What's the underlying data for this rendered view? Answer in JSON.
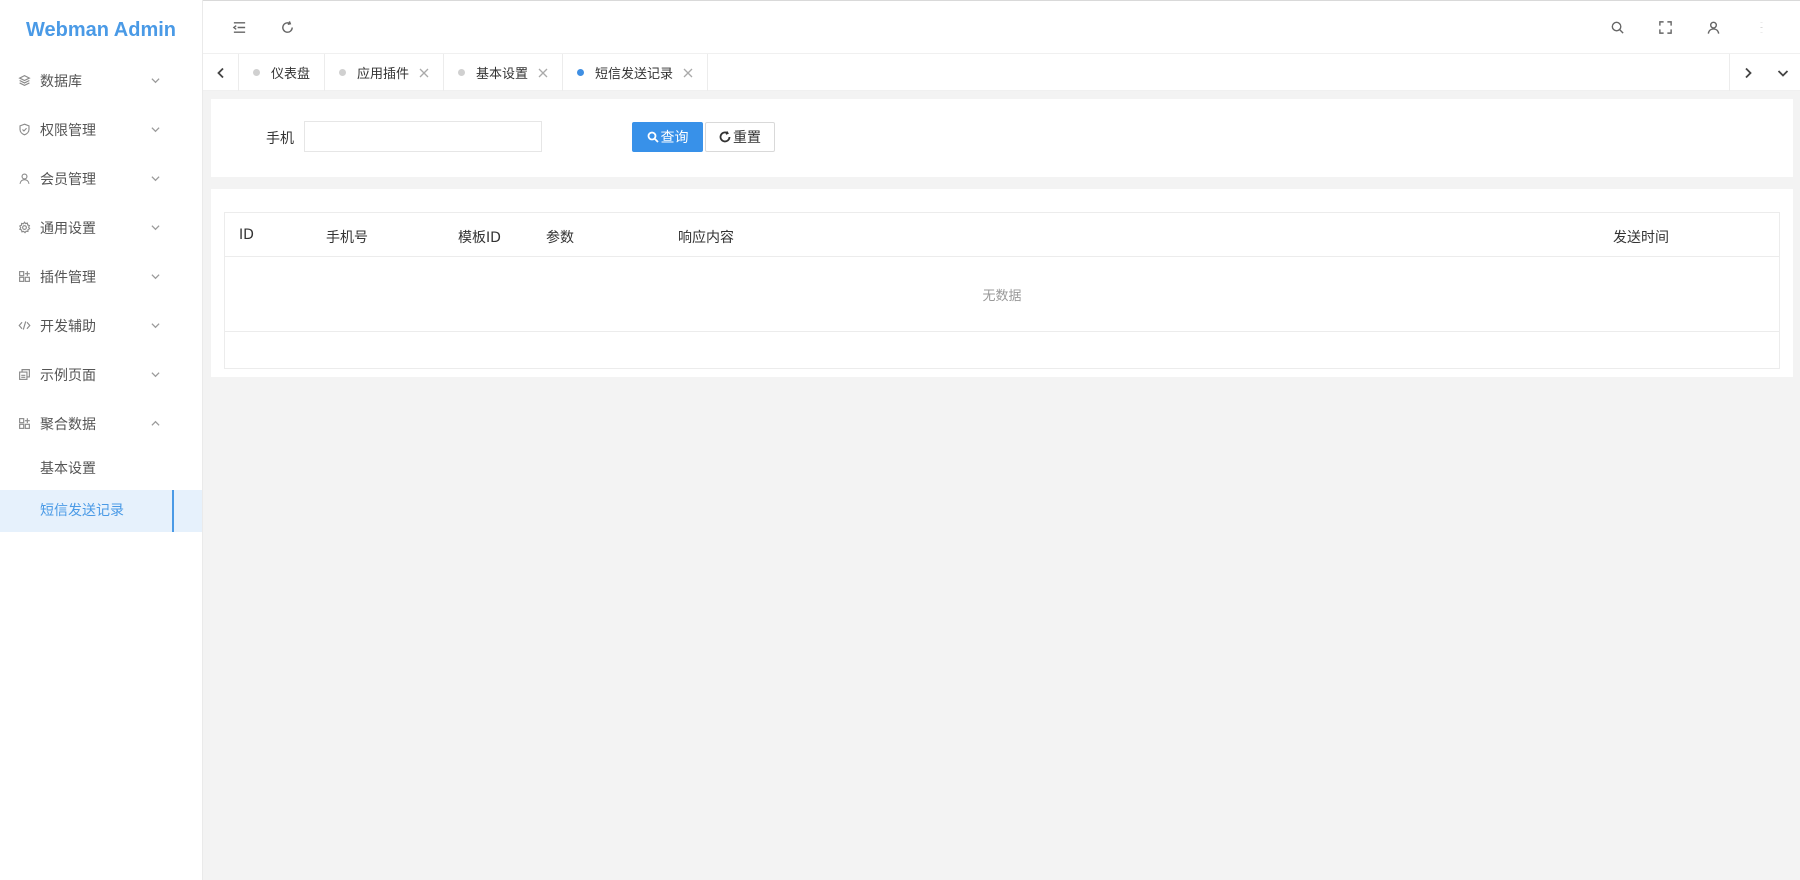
{
  "app": {
    "title": "Webman Admin"
  },
  "sidebar": {
    "items": [
      {
        "label": "数据库",
        "icon": "layers-icon",
        "expanded": false
      },
      {
        "label": "权限管理",
        "icon": "shield-check-icon",
        "expanded": false
      },
      {
        "label": "会员管理",
        "icon": "user-icon",
        "expanded": false
      },
      {
        "label": "通用设置",
        "icon": "gear-icon",
        "expanded": false
      },
      {
        "label": "插件管理",
        "icon": "apps-add-icon",
        "expanded": false
      },
      {
        "label": "开发辅助",
        "icon": "code-icon",
        "expanded": false
      },
      {
        "label": "示例页面",
        "icon": "template-icon",
        "expanded": false
      },
      {
        "label": "聚合数据",
        "icon": "apps-add-icon",
        "expanded": true
      }
    ],
    "subitems": [
      {
        "label": "基本设置",
        "active": false
      },
      {
        "label": "短信发送记录",
        "active": true
      }
    ]
  },
  "header": {
    "icons": [
      "menu-fold-icon",
      "refresh-icon",
      "search-icon",
      "fullscreen-icon",
      "user-icon",
      "more-vertical-icon"
    ]
  },
  "tabs": [
    {
      "label": "仪表盘",
      "closable": false,
      "active": false
    },
    {
      "label": "应用插件",
      "closable": true,
      "active": false
    },
    {
      "label": "基本设置",
      "closable": true,
      "active": false
    },
    {
      "label": "短信发送记录",
      "closable": true,
      "active": true
    }
  ],
  "search": {
    "phone_label": "手机",
    "phone_value": "",
    "query_label": "查询",
    "reset_label": "重置"
  },
  "table": {
    "columns": [
      "ID",
      "手机号",
      "模板ID",
      "参数",
      "响应内容",
      "发送时间"
    ],
    "empty_text": "无数据"
  },
  "colors": {
    "accent": "#3891e9",
    "logo": "#4a9ae6",
    "active_bg": "#e6f1fc"
  }
}
